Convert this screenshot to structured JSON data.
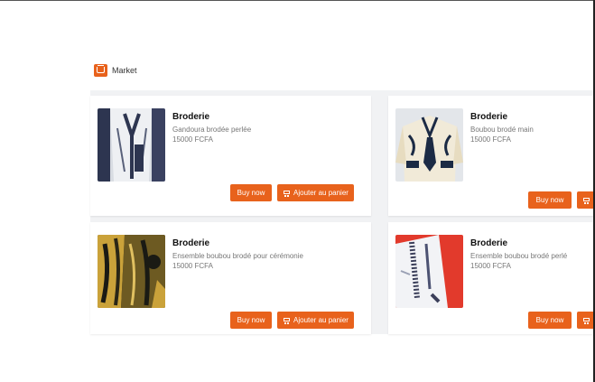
{
  "app": {
    "title": "Market"
  },
  "buttons": {
    "buy_now": "Buy now",
    "add_to_cart": "Ajouter au panier"
  },
  "products": [
    {
      "title": "Broderie",
      "description": "Gandoura brodée perlée",
      "price": "15000 FCFA"
    },
    {
      "title": "Broderie",
      "description": "Boubou brodé main",
      "price": "15000 FCFA"
    },
    {
      "title": "Broderie",
      "description": "Ensemble boubou brodé pour cérémonie",
      "price": "15000 FCFA"
    },
    {
      "title": "Broderie",
      "description": "Ensemble boubou brodé perlé",
      "price": "15000 FCFA"
    }
  ],
  "colors": {
    "accent": "#e8621c",
    "background": "#f1f2f4",
    "card": "#ffffff"
  }
}
